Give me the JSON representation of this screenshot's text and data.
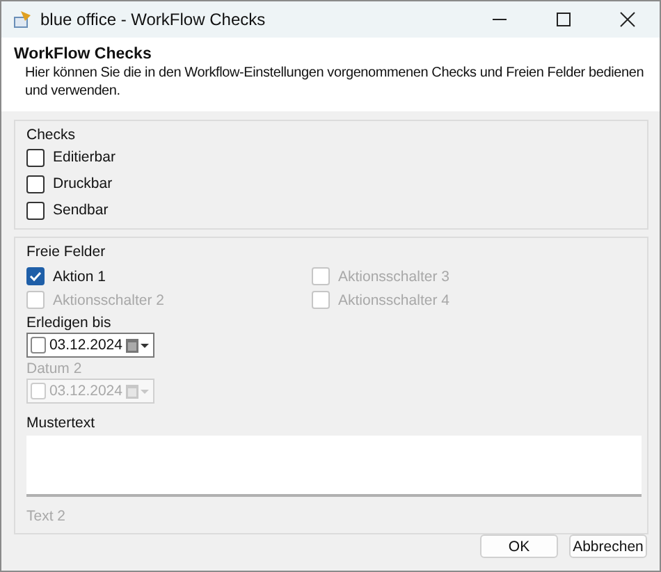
{
  "window": {
    "title": "blue office - WorkFlow Checks"
  },
  "header": {
    "title": "WorkFlow Checks",
    "description": "Hier können Sie die in den Workflow-Einstellungen vorgenommenen Checks und Freien Felder bedienen und verwenden."
  },
  "checks": {
    "label": "Checks",
    "items": [
      {
        "label": "Editierbar",
        "checked": false,
        "disabled": false
      },
      {
        "label": "Druckbar",
        "checked": false,
        "disabled": false
      },
      {
        "label": "Sendbar",
        "checked": false,
        "disabled": false
      }
    ]
  },
  "freie_felder": {
    "label": "Freie Felder",
    "switches": [
      {
        "label": "Aktion 1",
        "checked": true,
        "disabled": false
      },
      {
        "label": "Aktionsschalter 2",
        "checked": false,
        "disabled": true
      },
      {
        "label": "Aktionsschalter 3",
        "checked": false,
        "disabled": true
      },
      {
        "label": "Aktionsschalter 4",
        "checked": false,
        "disabled": true
      }
    ],
    "dates": [
      {
        "label": "Erledigen bis",
        "value": "03.12.2024",
        "checked": false,
        "disabled": false
      },
      {
        "label": "Datum 2",
        "value": "03.12.2024",
        "checked": false,
        "disabled": true
      }
    ],
    "texts": [
      {
        "label": "Mustertext",
        "has_field": true,
        "disabled": false
      },
      {
        "label": "Text 2",
        "has_field": false,
        "disabled": true
      }
    ]
  },
  "buttons": [
    {
      "label": "OK"
    },
    {
      "label": "Abbrechen"
    }
  ]
}
